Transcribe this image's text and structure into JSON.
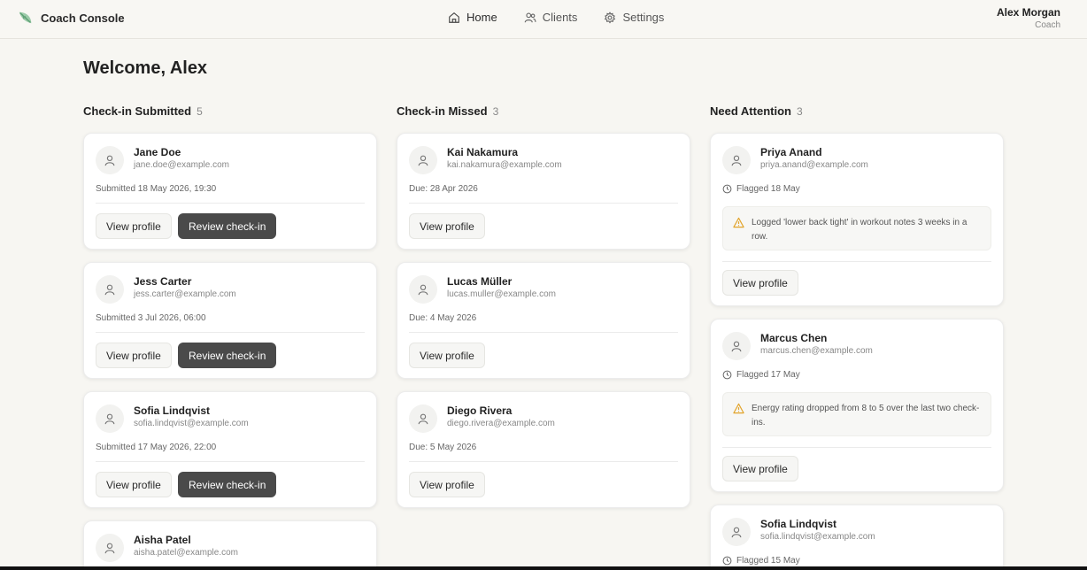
{
  "app": {
    "title": "Coach Console",
    "accent": "#7ab98f"
  },
  "nav": [
    {
      "label": "Home",
      "icon": "home-icon"
    },
    {
      "label": "Clients",
      "icon": "users-icon"
    },
    {
      "label": "Settings",
      "icon": "gear-icon"
    }
  ],
  "user": {
    "name": "Alex Morgan",
    "role": "Coach"
  },
  "welcome": "Welcome, Alex",
  "columns": [
    {
      "title": "Check-in Submitted",
      "count": "5",
      "cards": [
        {
          "name": "Jane Doe",
          "email": "jane.doe@example.com",
          "meta": "Submitted 18 May 2026, 19:30",
          "view": "View profile",
          "review": "Review check-in"
        },
        {
          "name": "Jess Carter",
          "email": "jess.carter@example.com",
          "meta": "Submitted 3 Jul 2026, 06:00",
          "view": "View profile",
          "review": "Review check-in"
        },
        {
          "name": "Sofia Lindqvist",
          "email": "sofia.lindqvist@example.com",
          "meta": "Submitted 17 May 2026, 22:00",
          "view": "View profile",
          "review": "Review check-in"
        },
        {
          "name": "Aisha Patel",
          "email": "aisha.patel@example.com"
        }
      ]
    },
    {
      "title": "Check-in Missed",
      "count": "3",
      "cards": [
        {
          "name": "Kai Nakamura",
          "email": "kai.nakamura@example.com",
          "meta": "Due: 28 Apr 2026",
          "view": "View profile"
        },
        {
          "name": "Lucas Müller",
          "email": "lucas.muller@example.com",
          "meta": "Due: 4 May 2026",
          "view": "View profile"
        },
        {
          "name": "Diego Rivera",
          "email": "diego.rivera@example.com",
          "meta": "Due: 5 May 2026",
          "view": "View profile"
        }
      ]
    },
    {
      "title": "Need Attention",
      "count": "3",
      "cards": [
        {
          "name": "Priya Anand",
          "email": "priya.anand@example.com",
          "meta": "Flagged 18 May",
          "note": "Logged 'lower back tight' in workout notes 3 weeks in a row.",
          "view": "View profile"
        },
        {
          "name": "Marcus Chen",
          "email": "marcus.chen@example.com",
          "meta": "Flagged 17 May",
          "note": "Energy rating dropped from 8 to 5 over the last two check-ins.",
          "view": "View profile"
        },
        {
          "name": "Sofia Lindqvist",
          "email": "sofia.lindqvist@example.com",
          "meta": "Flagged 15 May"
        }
      ]
    }
  ]
}
